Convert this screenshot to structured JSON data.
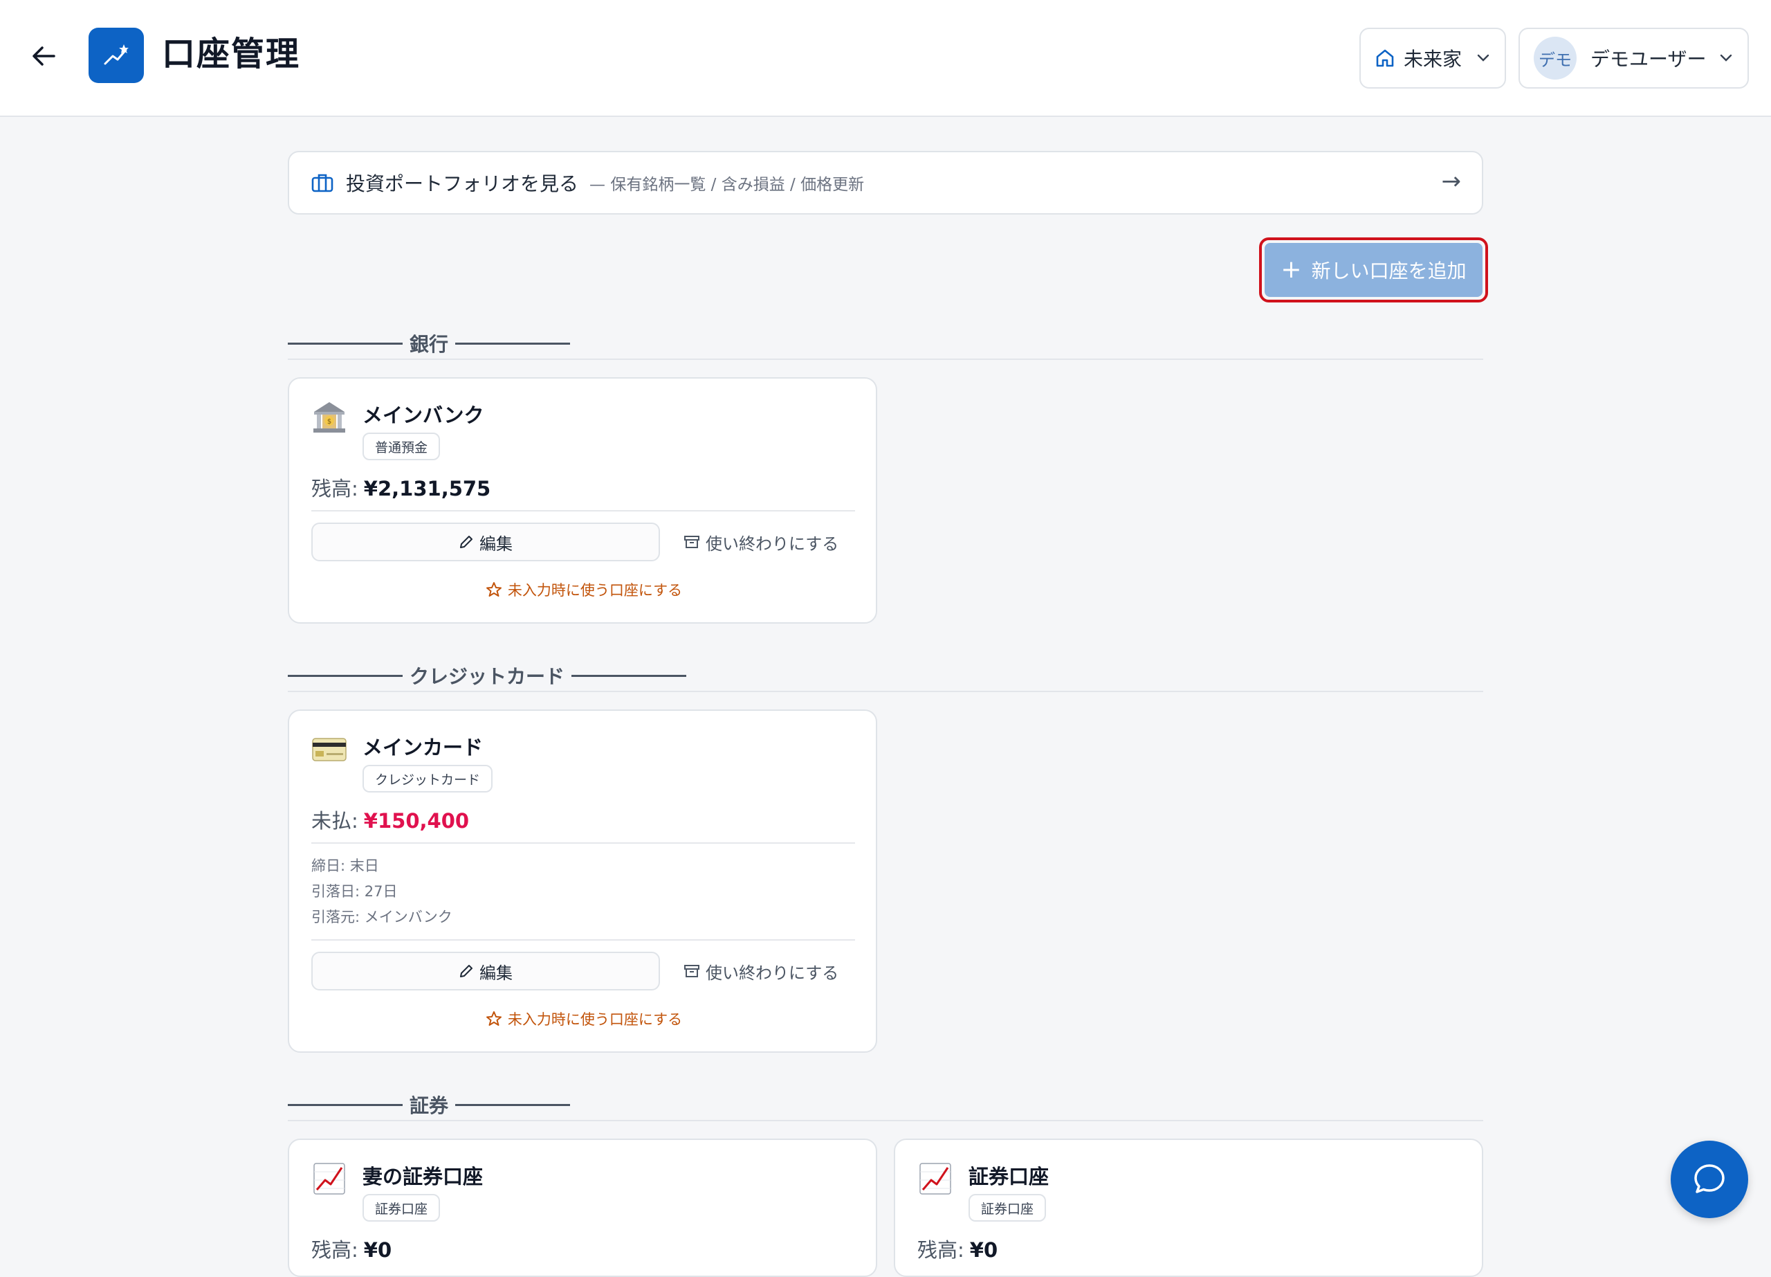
{
  "header": {
    "title": "口座管理",
    "household": "未来家",
    "avatar_text": "デモ",
    "user_name": "デモユーザー"
  },
  "portfolio_link": {
    "title": "投資ポートフォリオを見る",
    "subtitle": "— 保有銘柄一覧 / 含み損益 / 価格更新",
    "arrow": "→"
  },
  "add_account_button": {
    "plus": "+",
    "label": "新しい口座を追加"
  },
  "sections": {
    "bank": {
      "heading": "銀行",
      "accounts": [
        {
          "icon": "bank-icon",
          "name": "メインバンク",
          "type": "普通預金",
          "balance_label": "残高:",
          "balance": "¥2,131,575",
          "edit_label": "編集",
          "archive_label": "使い終わりにする",
          "default_label": "未入力時に使う口座にする"
        }
      ]
    },
    "credit": {
      "heading": "クレジットカード",
      "accounts": [
        {
          "icon": "credit-card-icon",
          "name": "メインカード",
          "type": "クレジットカード",
          "balance_label": "未払:",
          "balance": "¥150,400",
          "closing_day": "締日: 末日",
          "debit_day": "引落日: 27日",
          "debit_from": "引落元: メインバンク",
          "edit_label": "編集",
          "archive_label": "使い終わりにする",
          "default_label": "未入力時に使う口座にする"
        }
      ]
    },
    "securities": {
      "heading": "証券",
      "accounts": [
        {
          "icon": "chart-up-icon",
          "name": "妻の証券口座",
          "type": "証券口座",
          "balance_label": "残高:",
          "balance": "¥0"
        },
        {
          "icon": "chart-up-icon",
          "name": "証券口座",
          "type": "証券口座",
          "balance_label": "残高:",
          "balance": "¥0"
        }
      ]
    }
  },
  "colors": {
    "brand": "#0d63c5",
    "add_button": "#8cb2de",
    "highlight_border": "#d0121c",
    "negative_amount": "#e0114e",
    "default_link": "#c2540b"
  }
}
